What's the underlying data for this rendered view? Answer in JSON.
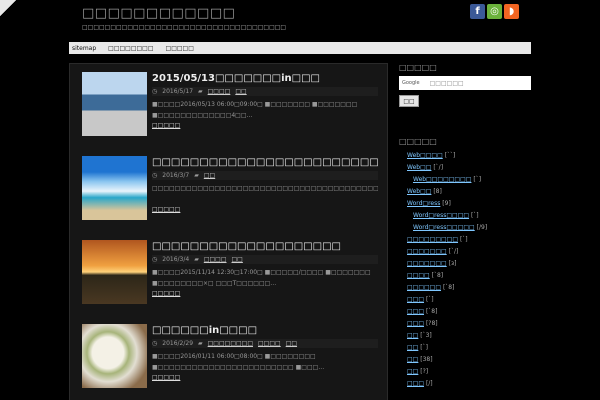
{
  "site": {
    "title": "□□□□□□□□□□□□",
    "description": "□□□□□□□□□□□□□□□□□□□□□□□□□□□□□□□□□□□□"
  },
  "social": {
    "facebook": "f",
    "feedly": "◎",
    "rss": "◗"
  },
  "nav": [
    "sitemap",
    "□□□□□□□□",
    "□□□□□"
  ],
  "posts": [
    {
      "title": "2015/05/13□□□□□□□in□□□",
      "date": "2016/5/17",
      "cats": [
        "□□□□",
        "□□"
      ],
      "excerpt": "■□□□□2016/05/13 06:00□09:00□ ■□□□□□□□ ■□□□□□□□ ■□□□□□□□□□□□□□4□□…",
      "more": "□□□□□"
    },
    {
      "title": "□□□□□□□□□□□□□□□□□□□□□□□□□□□□□□□□□",
      "date": "2016/3/7",
      "cats": [
        "□□"
      ],
      "excerpt": "□□□□□□□□□□□□□□□□□□□□□□□□□□□□□□□□□□□□□□□□□□□□□□□□□□3□□□□□□□□□□□□□□□□□□□□□□□□□□□□□□…",
      "more": "□□□□□"
    },
    {
      "title": "□□□□□□□□□□□□□□□□□□□□",
      "date": "2016/3/4",
      "cats": [
        "□□□□",
        "□□"
      ],
      "excerpt": "■□□□□2015/11/14 12:30□17:00□ ■□□□□□/□□□□ ■□□□□□□□ ■□□□□□□□□×□ □□□T□□□□□□…",
      "more": "□□□□□"
    },
    {
      "title": "□□□□□□in□□□□",
      "date": "2016/2/29",
      "cats": [
        "□□□□□□□□",
        "□□□□",
        "□□"
      ],
      "excerpt": "■□□□□2016/01/11 06:00□08:00□ ■□□□□□□□□ ■□□□□□□□□□□□□□□□□□□□□□□□□ ■□□□…",
      "more": "□□□□□"
    }
  ],
  "sidebar": {
    "search_heading": "□□□□□",
    "search_brand": "Google",
    "search_placeholder": "□□□□□□",
    "search_button": "□□",
    "cats_heading": "□□□□□",
    "categories": [
      {
        "name": "Web□□□□",
        "count": "[``]",
        "indent": 0
      },
      {
        "name": "Web□□",
        "count": "[`/]",
        "indent": 0
      },
      {
        "name": "Web□□□□□□□□",
        "count": "[`]",
        "indent": 1
      },
      {
        "name": "Web□□",
        "count": "[8]",
        "indent": 0
      },
      {
        "name": "Word□ress",
        "count": "[9]",
        "indent": 0
      },
      {
        "name": "Word□ress□□□□",
        "count": "[`]",
        "indent": 1
      },
      {
        "name": "Word□ress□□□□□",
        "count": "[/9]",
        "indent": 1
      },
      {
        "name": "□□□□□□□□□",
        "count": "[`]",
        "indent": 0
      },
      {
        "name": "□□□□□□□",
        "count": "[`/]",
        "indent": 0
      },
      {
        "name": "□□□□□□□",
        "count": "[з]",
        "indent": 0
      },
      {
        "name": "□□□□",
        "count": "[`8]",
        "indent": 0
      },
      {
        "name": "□□□□□□",
        "count": "[`8]",
        "indent": 0
      },
      {
        "name": "□□□",
        "count": "[`]",
        "indent": 0
      },
      {
        "name": "□□□",
        "count": "[`8]",
        "indent": 0
      },
      {
        "name": "□□□",
        "count": "[?8]",
        "indent": 0
      },
      {
        "name": "□□",
        "count": "[`3]",
        "indent": 0
      },
      {
        "name": "□□",
        "count": "[`]",
        "indent": 0
      },
      {
        "name": "□□",
        "count": "[38]",
        "indent": 0
      },
      {
        "name": "□□",
        "count": "[?]",
        "indent": 0
      },
      {
        "name": "□□□",
        "count": "[/]",
        "indent": 0
      }
    ]
  },
  "colors": {
    "background": "#000000",
    "content_bg": "#161616",
    "link": "#7fc7ff",
    "nav_bg": "#e9e9e9"
  }
}
